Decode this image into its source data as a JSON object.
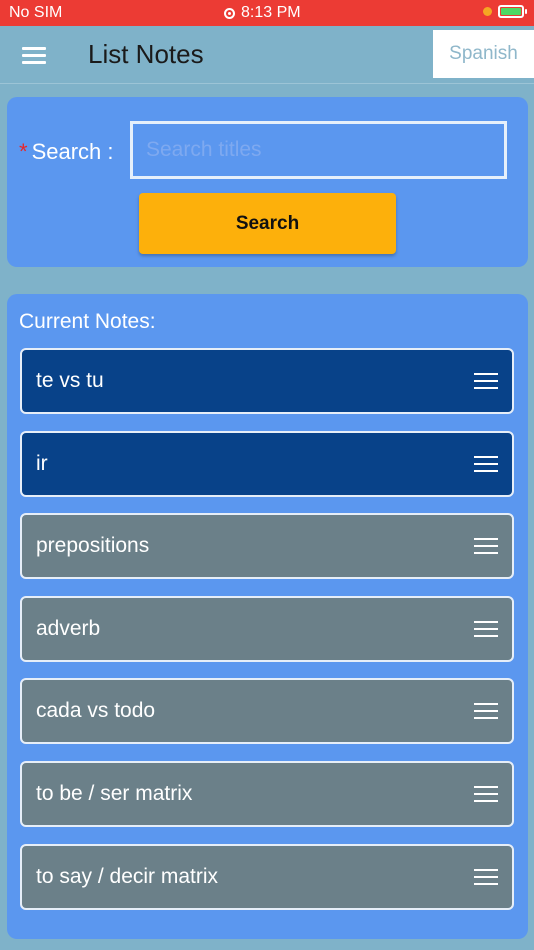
{
  "status_bar": {
    "carrier": "No SIM",
    "time": "8:13 PM"
  },
  "header": {
    "title": "List Notes",
    "language_button": "Spanish",
    "menu_icon": "hamburger-menu-icon"
  },
  "search": {
    "required_marker": "*",
    "label": "Search :",
    "placeholder": "Search titles",
    "value": "",
    "button_label": "Search"
  },
  "notes": {
    "heading": "Current Notes:",
    "items": [
      {
        "title": "te vs tu",
        "state": "active"
      },
      {
        "title": "ir",
        "state": "active"
      },
      {
        "title": "prepositions",
        "state": "inactive"
      },
      {
        "title": "adverb",
        "state": "inactive"
      },
      {
        "title": "cada vs todo",
        "state": "inactive"
      },
      {
        "title": "to be / ser matrix",
        "state": "inactive"
      },
      {
        "title": "to say / decir matrix",
        "state": "inactive"
      }
    ]
  },
  "colors": {
    "status_bar": "#ec3b34",
    "background": "#7fb2c9",
    "panel": "#5b97ef",
    "active_note": "#084289",
    "inactive_note": "#6b8089",
    "search_button": "#fdb00b",
    "required_marker": "#e8262a"
  }
}
